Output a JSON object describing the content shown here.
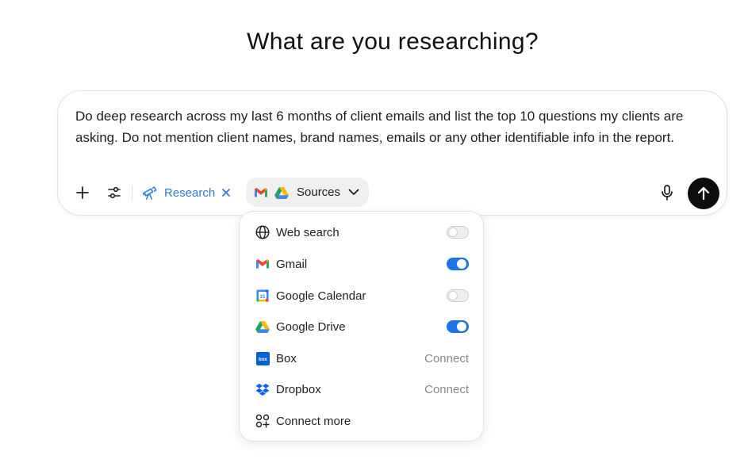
{
  "page": {
    "title": "What are you researching?"
  },
  "composer": {
    "prompt": "Do deep research across my last 6 months of client emails and list the top 10 questions my clients are asking. Do not mention client names, brand names, emails or any other identifiable info in the report.",
    "toolbar": {
      "add_icon": "plus-icon",
      "tools_icon": "sliders-icon",
      "research_chip": {
        "label": "Research",
        "icon": "telescope-icon",
        "close_icon": "close-icon"
      },
      "sources_chip": {
        "label": "Sources",
        "icons": [
          "gmail-icon",
          "google-drive-icon"
        ],
        "chevron": "chevron-down-icon"
      },
      "mic_icon": "microphone-icon",
      "send_icon": "arrow-up-icon"
    }
  },
  "sources_menu": {
    "items": [
      {
        "label": "Web search",
        "icon": "globe-icon",
        "control": "toggle",
        "enabled": false
      },
      {
        "label": "Gmail",
        "icon": "gmail-icon",
        "control": "toggle",
        "enabled": true
      },
      {
        "label": "Google Calendar",
        "icon": "google-calendar-icon",
        "control": "toggle",
        "enabled": false
      },
      {
        "label": "Google Drive",
        "icon": "google-drive-icon",
        "control": "toggle",
        "enabled": true
      },
      {
        "label": "Box",
        "icon": "box-icon",
        "control": "link",
        "action_label": "Connect"
      },
      {
        "label": "Dropbox",
        "icon": "dropbox-icon",
        "control": "link",
        "action_label": "Connect"
      },
      {
        "label": "Connect more",
        "icon": "apps-add-icon",
        "control": "none"
      }
    ]
  },
  "colors": {
    "accent": "#1a73e8",
    "research_chip": "#2f7be0",
    "send_button": "#0d0d0d",
    "chip_bg": "#f0f0f0"
  }
}
